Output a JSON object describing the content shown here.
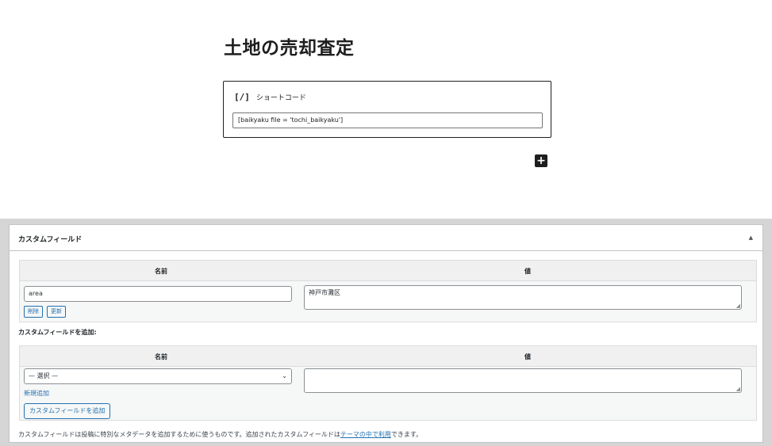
{
  "editor": {
    "post_title": "土地の売却査定",
    "shortcode_block": {
      "icon": "[/]",
      "label": "ショートコード",
      "value": "[baikyaku file = 'tochi_baikyaku']"
    },
    "inserter_label": "+"
  },
  "custom_fields": {
    "title": "カスタムフィールド",
    "toggle_icon": "▲",
    "table": {
      "col_name": "名前",
      "col_value": "値",
      "rows": [
        {
          "name": "area",
          "value": "神戸市灘区",
          "delete_label": "削除",
          "update_label": "更新"
        }
      ]
    },
    "add_section": {
      "label": "カスタムフィールドを追加:",
      "col_name": "名前",
      "col_value": "値",
      "select_value": "— 選択 —",
      "new_link": "新規追加",
      "add_button": "カスタムフィールドを追加",
      "value_text": ""
    },
    "footnote_before": "カスタムフィールドは投稿に特別なメタデータを追加するために使うものです。追加されたカスタムフィールドは",
    "footnote_link": "テーマの中で利用",
    "footnote_after": "できます。"
  }
}
